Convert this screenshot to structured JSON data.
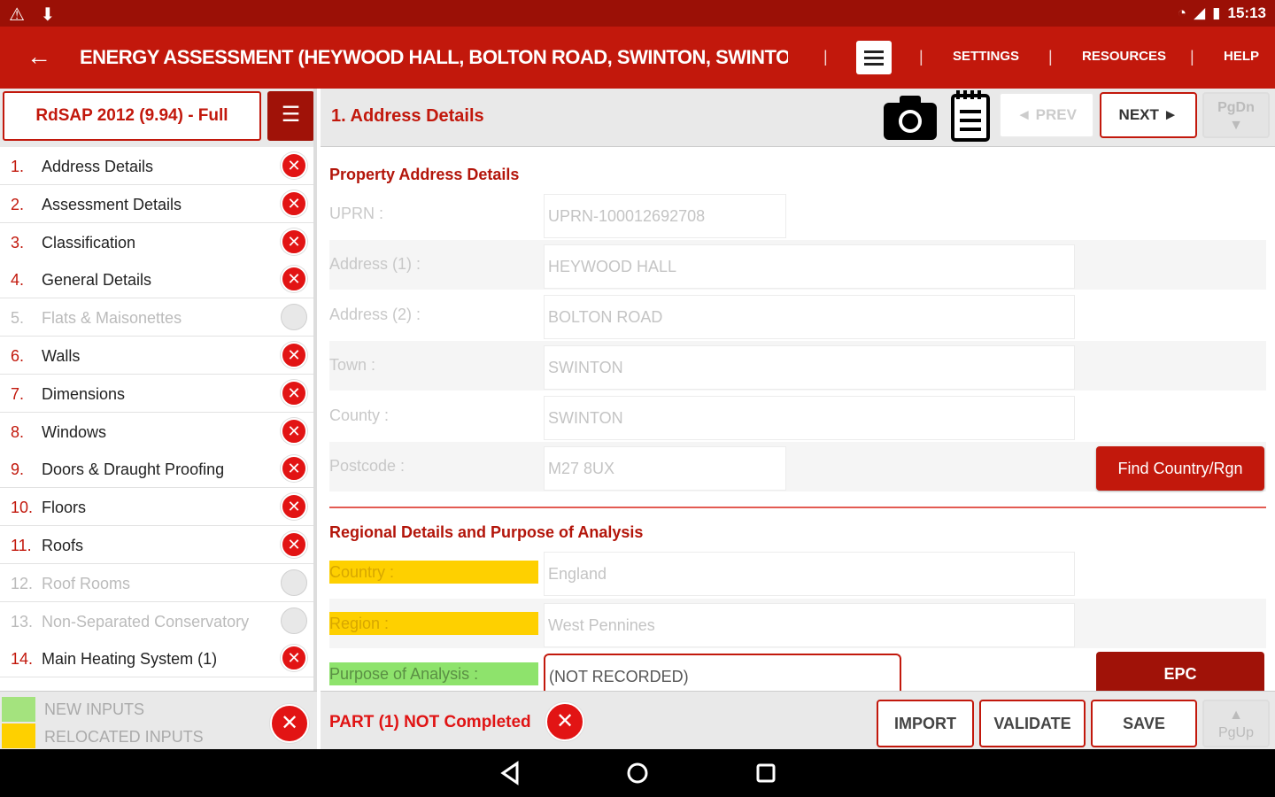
{
  "status_bar": {
    "left_icons": "⚠ ⬇",
    "time": "15:13"
  },
  "app_bar": {
    "title": "ENERGY ASSESSMENT (HEYWOOD HALL, BOLTON ROAD, SWINTON, SWINTO...",
    "separator": "|",
    "links": [
      "SETTINGS",
      "RESOURCES",
      "HELP"
    ]
  },
  "sidebar": {
    "version": "RdSAP 2012 (9.94) - Full",
    "items": [
      {
        "num": "1.",
        "label": "Address Details",
        "status": "error",
        "enabled": true
      },
      {
        "num": "2.",
        "label": "Assessment Details",
        "status": "error",
        "enabled": true
      },
      {
        "num": "3.",
        "label": "Classification",
        "status": "error",
        "enabled": true
      },
      {
        "num": "4.",
        "label": "General Details",
        "status": "error",
        "enabled": true
      },
      {
        "num": "5.",
        "label": "Flats & Maisonettes",
        "status": "empty",
        "enabled": false
      },
      {
        "num": "6.",
        "label": "Walls",
        "status": "error",
        "enabled": true
      },
      {
        "num": "7.",
        "label": "Dimensions",
        "status": "error",
        "enabled": true
      },
      {
        "num": "8.",
        "label": "Windows",
        "status": "error",
        "enabled": true
      },
      {
        "num": "9.",
        "label": "Doors & Draught Proofing",
        "status": "error",
        "enabled": true
      },
      {
        "num": "10.",
        "label": "Floors",
        "status": "error",
        "enabled": true
      },
      {
        "num": "11.",
        "label": "Roofs",
        "status": "error",
        "enabled": true
      },
      {
        "num": "12.",
        "label": "Roof Rooms",
        "status": "empty",
        "enabled": false
      },
      {
        "num": "13.",
        "label": "Non-Separated Conservatory",
        "status": "empty",
        "enabled": false
      },
      {
        "num": "14.",
        "label": "Main Heating System (1)",
        "status": "error",
        "enabled": true
      }
    ],
    "legend": {
      "new_inputs": "NEW INPUTS",
      "relocated_inputs": "RELOCATED INPUTS",
      "new_color": "#a4e37e",
      "relocated_color": "#fed000"
    }
  },
  "main": {
    "section_title": "1. Address Details",
    "prev_label": "◄ PREV",
    "next_label": "NEXT ►",
    "pgdn_label": "PgDn",
    "property_title": "Property Address Details",
    "fields": [
      {
        "label": "UPRN :",
        "value": "UPRN-100012692708"
      },
      {
        "label": "Address (1) :",
        "value": "HEYWOOD HALL"
      },
      {
        "label": "Address (2) :",
        "value": "BOLTON ROAD"
      },
      {
        "label": "Town :",
        "value": "SWINTON"
      },
      {
        "label": "County :",
        "value": "SWINTON"
      },
      {
        "label": "Postcode :",
        "value": "M27 8UX"
      }
    ],
    "find_button": "Find Country/Rgn",
    "regional_title": "Regional Details and Purpose of Analysis",
    "regional_fields": [
      {
        "label": "Country :",
        "value": "England"
      },
      {
        "label": "Region :",
        "value": "West Pennines"
      },
      {
        "label": "Purpose of Analysis :",
        "value": "(NOT RECORDED)"
      }
    ],
    "epc_button": "EPC"
  },
  "bottom_bar": {
    "status_text": "PART (1) NOT Completed",
    "import_label": "IMPORT",
    "validate_label": "VALIDATE",
    "save_label": "SAVE",
    "pgup_label": "PgUp"
  },
  "colors": {
    "primary": "#c2180c",
    "dark_primary": "#9b1006",
    "error": "#e21414"
  }
}
